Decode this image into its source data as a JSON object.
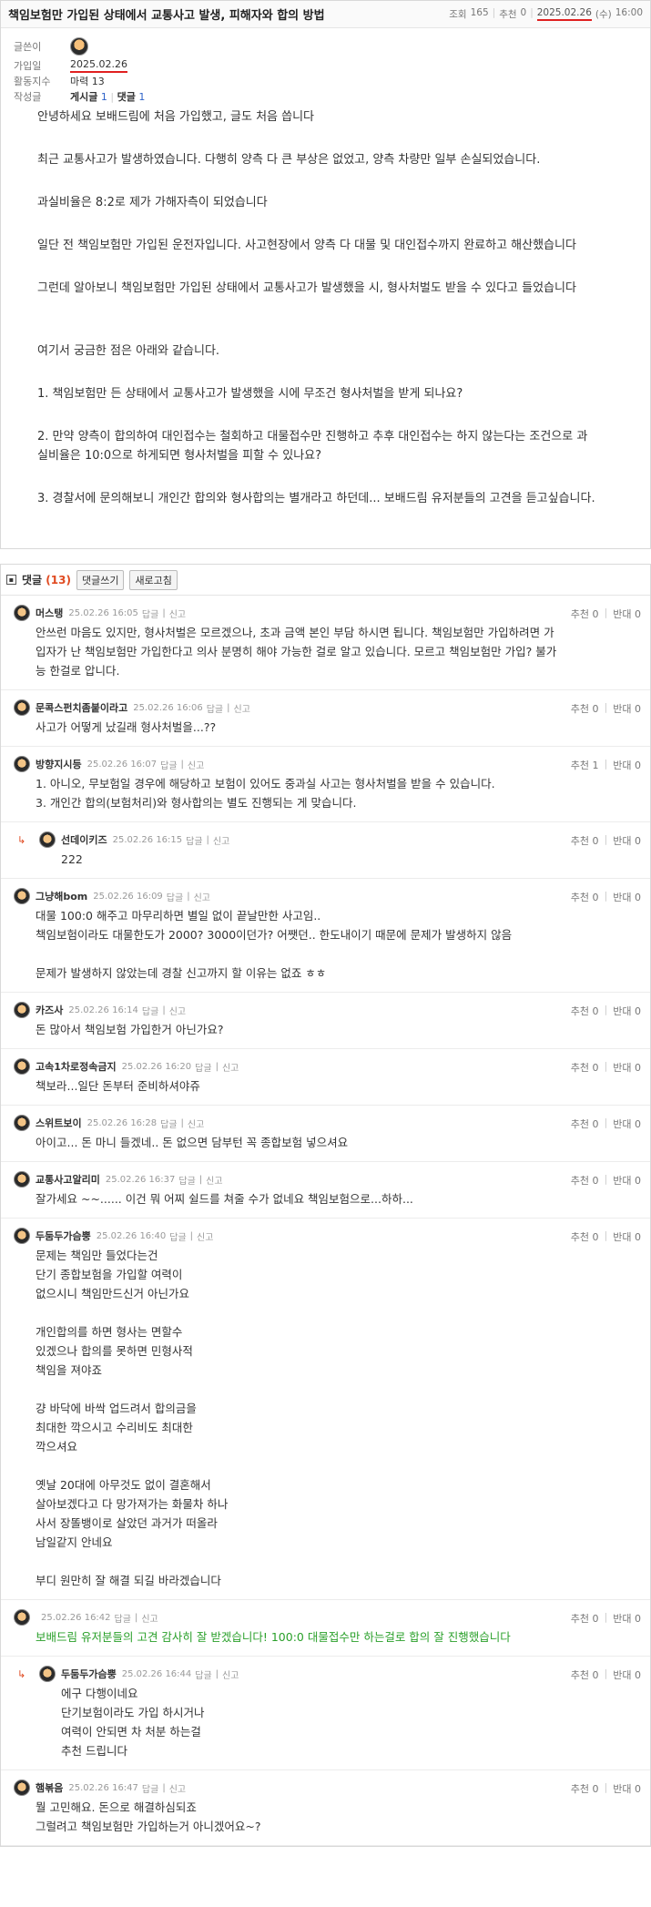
{
  "post": {
    "title": "책임보험만 가입된 상태에서 교통사고 발생, 피해자와 합의 방법",
    "views_label": "조회",
    "views": "165",
    "recommend_label": "추천",
    "recommend": "0",
    "date": "2025.02.26",
    "weekday": "(수)",
    "time": "16:00",
    "info": {
      "author_label": "글쓴이",
      "joined_label": "가입일",
      "joined": "2025.02.26",
      "activity_label": "활동지수",
      "activity": "마력 13",
      "works_label": "작성글",
      "posts_label": "게시글",
      "posts": "1",
      "comments_label": "댓글",
      "comments": "1"
    },
    "body": [
      "안녕하세요 보배드림에 처음 가입했고, 글도 처음 씁니다",
      "최근 교통사고가 발생하였습니다. 다행히 양측 다 큰 부상은 없었고, 양측 차량만 일부 손실되었습니다.",
      "과실비율은 8:2로 제가 가해자측이 되었습니다",
      "일단 전 책임보험만 가입된 운전자입니다. 사고현장에서 양측 다 대물 및 대인접수까지 완료하고 해산했습니다",
      "그런데 알아보니 책임보험만 가입된 상태에서 교통사고가 발생했을 시, 형사처벌도 받을 수 있다고 들었습니다",
      "여기서 궁금한 점은 아래와 같습니다.",
      "1. 책임보험만 든 상태에서 교통사고가 발생했을 시에 무조건 형사처벌을 받게 되나요?",
      "2. 만약 양측이 합의하여 대인접수는 철회하고 대물접수만 진행하고 추후 대인접수는 하지 않는다는 조건으로 과",
      "실비율은 10:0으로 하게되면 형사처벌을 피할 수 있나요?",
      "3. 경찰서에 문의해보니 개인간 합의와 형사합의는 별개라고 하던데... 보배드림 유저분들의 고견을 듣고싶습니다."
    ]
  },
  "comments_bar": {
    "title": "댓글",
    "count": "(13)",
    "write_label": "댓글쓰기",
    "refresh_label": "새로고침"
  },
  "comment_ui": {
    "reply_label": "답글",
    "report_label": "신고",
    "up_label": "추천",
    "down_label": "반대"
  },
  "comments": [
    {
      "nick": "머스탱",
      "time": "25.02.26 16:05",
      "up": "0",
      "down": "0",
      "lines": [
        "안쓰런 마음도 있지만, 형사처벌은 모르겠으나, 초과 금액 본인 부담 하시면 됩니다. 책임보험만 가입하려면 가",
        "입자가 난 책임보험만 가입한다고 의사 분명히 해야 가능한 걸로 알고 있습니다. 모르고 책임보험만 가입? 불가",
        "능 한걸로 압니다."
      ]
    },
    {
      "nick": "문콕스펀치좀붙이라고",
      "time": "25.02.26 16:06",
      "up": "0",
      "down": "0",
      "lines": [
        "사고가 어떻게 났길래 형사처벌을...??"
      ]
    },
    {
      "nick": "방향지시등",
      "time": "25.02.26 16:07",
      "up": "1",
      "down": "0",
      "lines": [
        "1. 아니오, 무보험일 경우에 해당하고 보험이 있어도 중과실 사고는 형사처벌을 받을 수 있습니다.",
        "3. 개인간 합의(보험처리)와 형사합의는 별도 진행되는 게 맞습니다."
      ]
    },
    {
      "nick": "선데이키즈",
      "time": "25.02.26 16:15",
      "up": "0",
      "down": "0",
      "lines": [
        "222"
      ]
    },
    {
      "nick": "그냥해bom",
      "time": "25.02.26 16:09",
      "up": "0",
      "down": "0",
      "lines": [
        "대물 100:0 해주고 마무리하면 별일 없이 끝날만한 사고임..",
        "책임보험이라도 대물한도가 2000? 3000이던가? 어쨋던.. 한도내이기 때문에 문제가 발생하지 않음",
        "",
        "문제가 발생하지 않았는데 경찰 신고까지 할 이유는 없죠 ㅎㅎ"
      ]
    },
    {
      "nick": "카즈사",
      "time": "25.02.26 16:14",
      "up": "0",
      "down": "0",
      "lines": [
        "돈 많아서 책임보험 가입한거 아닌가요?"
      ]
    },
    {
      "nick": "고속1차로정속금지",
      "time": "25.02.26 16:20",
      "up": "0",
      "down": "0",
      "lines": [
        "책보라...일단 돈부터 준비하셔야쥬"
      ]
    },
    {
      "nick": "스위트보이",
      "time": "25.02.26 16:28",
      "up": "0",
      "down": "0",
      "lines": [
        "아이고... 돈 마니 들겠네.. 돈 없으면 담부턴 꼭 종합보험 넣으셔요"
      ]
    },
    {
      "nick": "교통사고알리미",
      "time": "25.02.26 16:37",
      "up": "0",
      "down": "0",
      "lines": [
        "잘가세요 ~~...... 이건 뭐 어찌 쉴드를 쳐줄 수가 없네요 책임보험으로...하하..."
      ]
    },
    {
      "nick": "두둠두가슴뿡",
      "time": "25.02.26 16:40",
      "up": "0",
      "down": "0",
      "lines": [
        "문제는 책임만 들었다는건",
        "단기 종합보험을 가입할 여력이",
        "없으시니 책임만드신거 아닌가요",
        "",
        "개인합의를 하면 형사는 면할수",
        "있겠으나 합의를 못하면 민형사적",
        "책임을 져야죠",
        "",
        "걍 바닥에 바싹 업드려서 합의금을",
        "최대한 깍으시고 수리비도 최대한",
        "깍으셔요",
        "",
        "옛날 20대에 아무것도 없이 결혼해서",
        "살아보겠다고 다 망가져가는 화물차 하나",
        "사서 장똘뱅이로 살았던 과거가 떠올라",
        "남일같지 안네요",
        "",
        "부디 원만히 잘 해결 되길 바라겠습니다"
      ]
    },
    {
      "nick": "",
      "time": "25.02.26 16:42",
      "up": "0",
      "down": "0",
      "lines": [
        "보배드림 유저분들의 고견 감사히 잘 받겠습니다! 100:0 대물접수만 하는걸로 합의 잘 진행했습니다"
      ]
    },
    {
      "nick": "두둠두가슴뿡",
      "time": "25.02.26 16:44",
      "up": "0",
      "down": "0",
      "lines": [
        "에구 다행이네요",
        "단기보험이라도 가입 하시거나",
        "여력이 안되면 차 처분 하는걸",
        "추천 드립니다"
      ]
    },
    {
      "nick": "햄볶음",
      "time": "25.02.26 16:47",
      "up": "0",
      "down": "0",
      "lines": [
        "뭘 고민해요. 돈으로 해결하심되죠",
        "그럴려고 책임보험만 가입하는거 아니겠어요~?"
      ]
    }
  ]
}
